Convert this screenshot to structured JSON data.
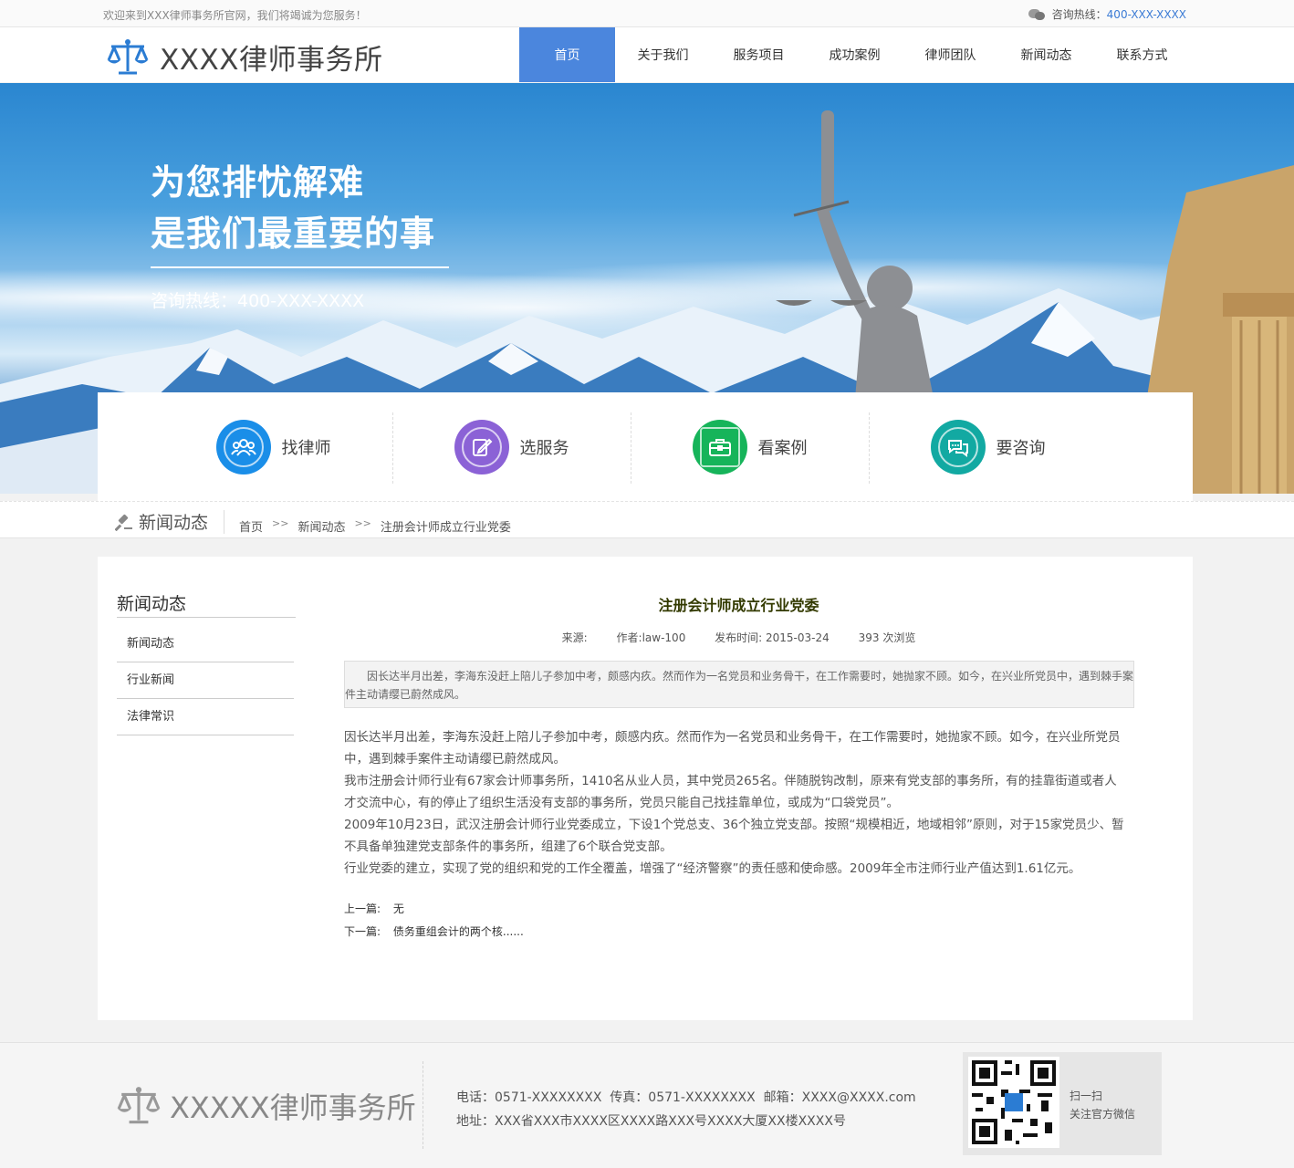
{
  "topbar": {
    "welcome": "欢迎来到XXX律师事务所官网，我们将竭诚为您服务！",
    "hotline_label": "咨询热线：",
    "hotline_number": "400-XXX-XXXX"
  },
  "header": {
    "logo_text": "XXXX律师事务所",
    "nav": [
      {
        "label": "首页",
        "active": true
      },
      {
        "label": "关于我们"
      },
      {
        "label": "服务项目"
      },
      {
        "label": "成功案例"
      },
      {
        "label": "律师团队"
      },
      {
        "label": "新闻动态"
      },
      {
        "label": "联系方式"
      }
    ]
  },
  "banner": {
    "line1": "为您排忧解难",
    "line2": "是我们最重要的事",
    "tel": "咨询热线：400-XXX-XXXX"
  },
  "services": [
    {
      "label": "找律师",
      "color": "#1a8ee8",
      "icon": "people-icon"
    },
    {
      "label": "选服务",
      "color": "#8b62d6",
      "icon": "edit-icon"
    },
    {
      "label": "看案例",
      "color": "#16b45a",
      "icon": "briefcase-icon"
    },
    {
      "label": "要咨询",
      "color": "#12a9a2",
      "icon": "chat-icon"
    }
  ],
  "crumb": {
    "section": "新闻动态",
    "path": [
      "首页",
      "新闻动态",
      "注册会计师成立行业党委"
    ],
    "sep": ">>"
  },
  "sidebar": {
    "title": "新闻动态",
    "items": [
      "新闻动态",
      "行业新闻",
      "法律常识"
    ]
  },
  "article": {
    "title": "注册会计师成立行业党委",
    "source": "来源:",
    "author": "作者:law-100",
    "date": "发布时间: 2015-03-24",
    "views": "393 次浏览",
    "summary": "因长达半月出差，李海东没赶上陪儿子参加中考，颇感内疚。然而作为一名党员和业务骨干，在工作需要时，她抛家不顾。如今，在兴业所党员中，遇到棘手案件主动请缨已蔚然成风。",
    "paragraphs": [
      "因长达半月出差，李海东没赶上陪儿子参加中考，颇感内疚。然而作为一名党员和业务骨干，在工作需要时，她抛家不顾。如今，在兴业所党员中，遇到棘手案件主动请缨已蔚然成风。",
      "我市注册会计师行业有67家会计师事务所，1410名从业人员，其中党员265名。伴随脱钩改制，原来有党支部的事务所，有的挂靠街道或者人才交流中心，有的停止了组织生活没有支部的事务所，党员只能自己找挂靠单位，或成为“口袋党员”。",
      "2009年10月23日，武汉注册会计师行业党委成立，下设1个党总支、36个独立党支部。按照“规模相近，地域相邻”原则，对于15家党员少、暂不具备单独建党支部条件的事务所，组建了6个联合党支部。",
      "行业党委的建立，实现了党的组织和党的工作全覆盖，增强了“经济警察”的责任感和使命感。2009年全市注师行业产值达到1.61亿元。"
    ],
    "prev_label": "上一篇:",
    "prev_value": "无",
    "next_label": "下一篇:",
    "next_value": "债务重组会计的两个核......"
  },
  "footer": {
    "logo_text": "XXXXX律师事务所",
    "contact": "电话：0571-XXXXXXXX  传真：0571-XXXXXXXX  邮箱：XXXX@XXXX.com",
    "address": "地址：XXX省XXX市XXXX区XXXX路XXX号XXXX大厦XX楼XXXX号",
    "qr_line1": "扫一扫",
    "qr_line2": "关注官方微信"
  }
}
